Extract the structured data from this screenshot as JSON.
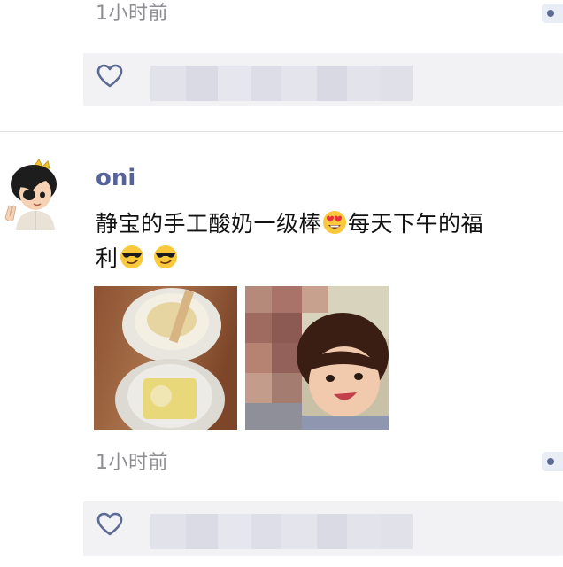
{
  "feed": {
    "previous_post": {
      "time": "1小时前"
    },
    "post": {
      "username": "oni",
      "text_line1": "静宝的手工酸奶一级棒",
      "text_line1_after_emoji": "每天下午的福",
      "text_line2": "利",
      "emojis": [
        "heart-eyes-emoji",
        "sunglasses-emoji",
        "sunglasses-emoji"
      ],
      "photos": [
        "yogurt-jars-photo",
        "child-selfie-photo"
      ],
      "time": "1小时前"
    }
  },
  "colors": {
    "username": "#56629a",
    "time": "#8e8e93",
    "likes_bar": "#f2f2f5",
    "heart": "#5b6b93"
  }
}
